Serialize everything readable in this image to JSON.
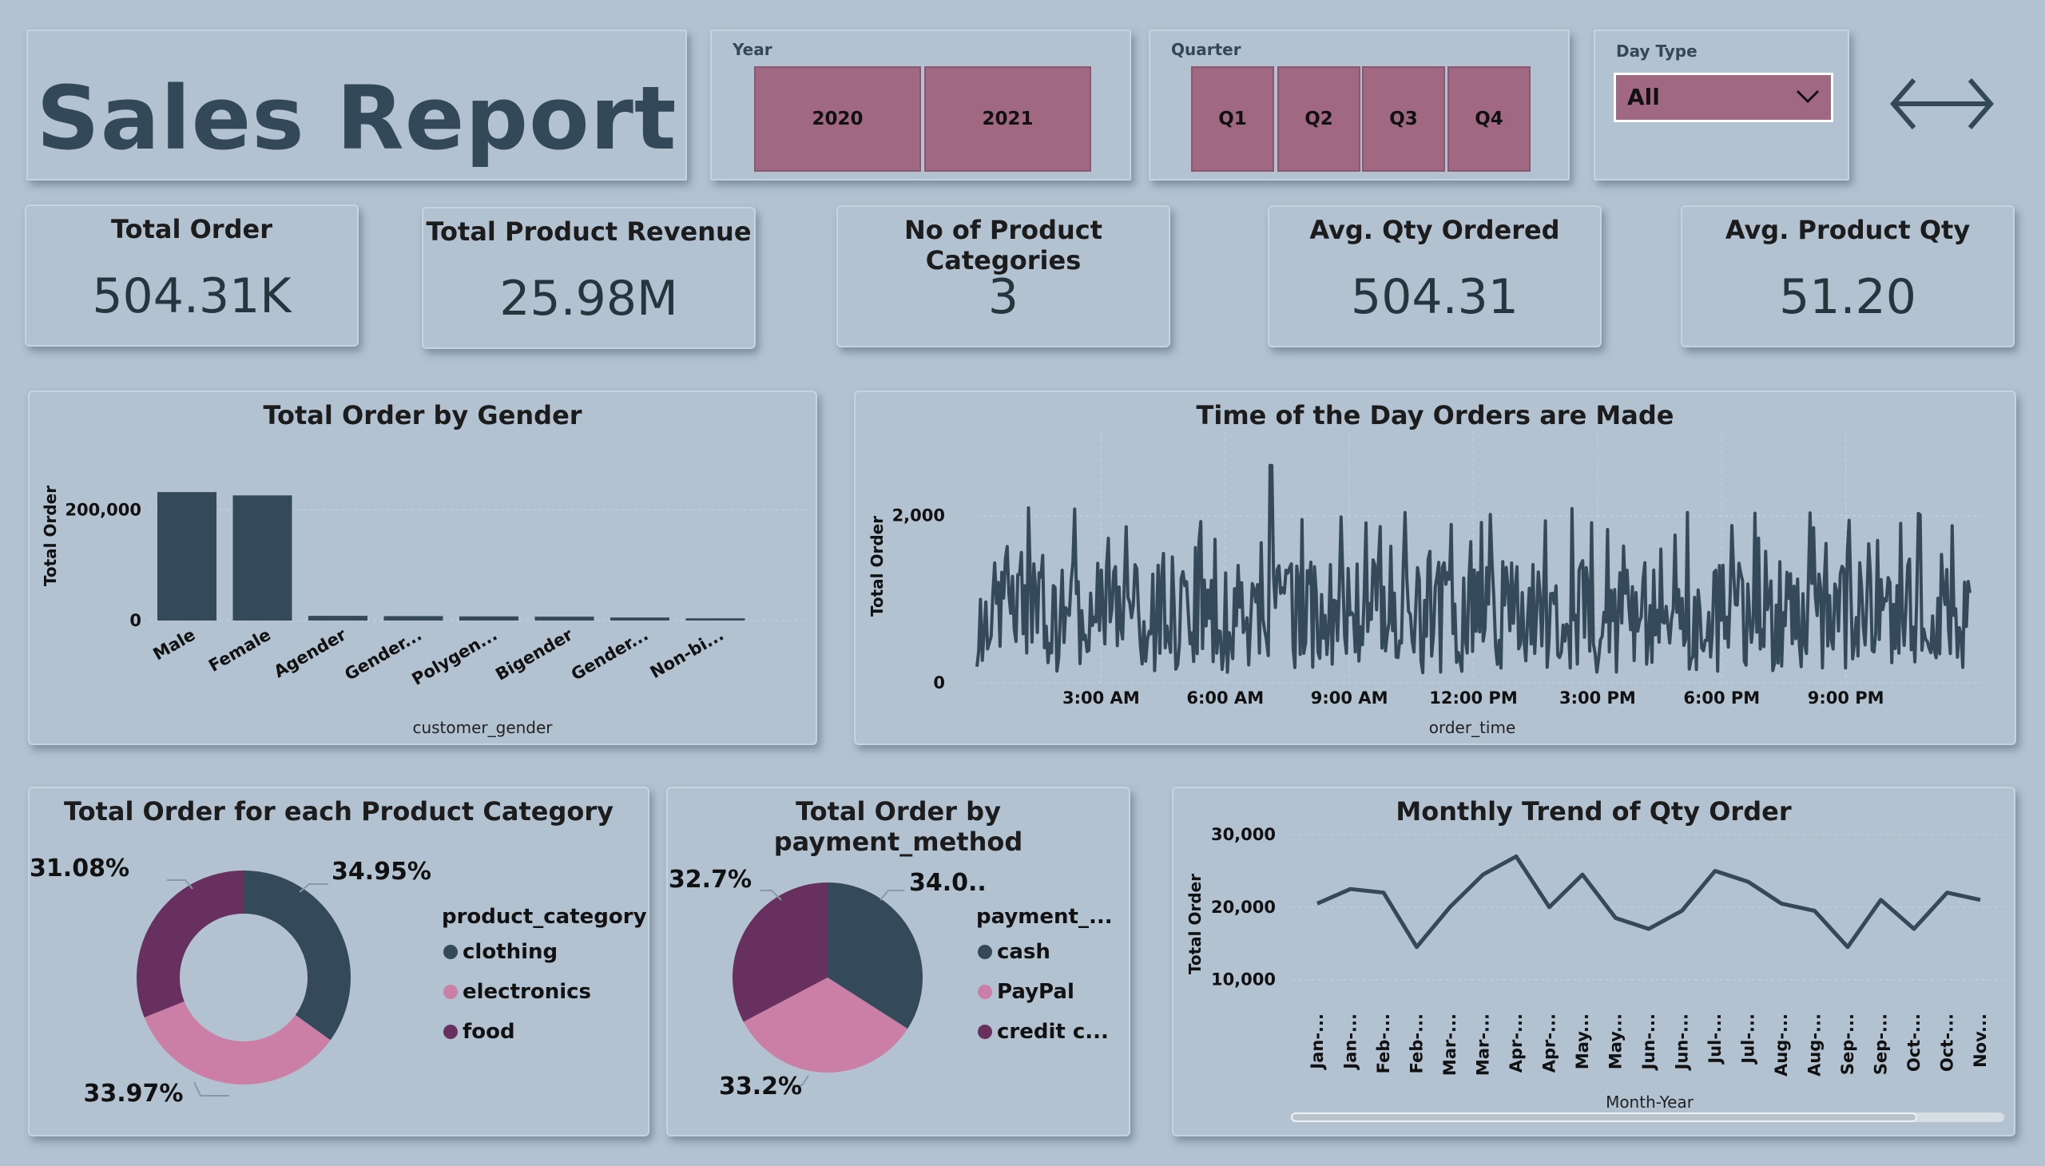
{
  "header": {
    "title": "Sales Report"
  },
  "slicers": {
    "year": {
      "label": "Year",
      "options": [
        "2020",
        "2021"
      ]
    },
    "quarter": {
      "label": "Quarter",
      "options": [
        "Q1",
        "Q2",
        "Q3",
        "Q4"
      ]
    },
    "day_type": {
      "label": "Day Type",
      "selected": "All"
    }
  },
  "nav": {
    "arrows_icon": "left-right-arrows-icon"
  },
  "kpis": [
    {
      "title": "Total Order",
      "value": "504.31K"
    },
    {
      "title": "Total Product Revenue",
      "value": "25.98M"
    },
    {
      "title": "No of Product Categories",
      "value": "3"
    },
    {
      "title": "Avg. Qty Ordered",
      "value": "504.31"
    },
    {
      "title": "Avg. Product Qty",
      "value": "51.20"
    }
  ],
  "colors": {
    "background": "#b2c2d0",
    "dark": "#34495a",
    "pink": "#cb7fa6",
    "purple": "#67305f",
    "tile": "#a16882"
  },
  "charts": {
    "gender": {
      "title": "Total Order by Gender",
      "xlabel": "customer_gender",
      "ylabel": "Total Order",
      "ticks": [
        "0",
        "200,000"
      ]
    },
    "time": {
      "title": "Time of the Day Orders are Made",
      "xlabel": "order_time",
      "ylabel": "Total Order",
      "yticks": [
        "0",
        "2,000"
      ],
      "xticks": [
        "3:00 AM",
        "6:00 AM",
        "9:00 AM",
        "12:00 PM",
        "3:00 PM",
        "6:00 PM",
        "9:00 PM"
      ]
    },
    "category": {
      "title": "Total Order for each Product Category",
      "legend_title": "product_category",
      "labels": [
        "34.95%",
        "33.97%",
        "31.08%"
      ]
    },
    "payment": {
      "title": "Total Order by payment_method",
      "legend_title": "payment_...",
      "labels": [
        "34.0...",
        "33.2%",
        "32.7%"
      ]
    },
    "monthly": {
      "title": "Monthly Trend of Qty Order",
      "xlabel": "Month-Year",
      "ylabel": "Total Order",
      "yticks": [
        "10,000",
        "20,000",
        "30,000"
      ]
    }
  },
  "chart_data": [
    {
      "type": "bar",
      "title": "Total Order by Gender",
      "xlabel": "customer_gender",
      "ylabel": "Total Order",
      "ylim": [
        0,
        300000
      ],
      "categories": [
        "Male",
        "Female",
        "Agender",
        "Gender...",
        "Polygen...",
        "Bigender",
        "Gender...",
        "Non-bi..."
      ],
      "values": [
        232000,
        226000,
        8500,
        8000,
        7500,
        7000,
        5500,
        4000
      ]
    },
    {
      "type": "line",
      "title": "Time of the Day Orders are Made",
      "xlabel": "order_time",
      "ylabel": "Total Order",
      "ylim": [
        0,
        3000
      ],
      "x_range_hours": [
        0,
        24
      ],
      "peak": 2600,
      "typical_range": [
        200,
        1800
      ]
    },
    {
      "type": "pie",
      "title": "Total Order for each Product Category",
      "legend_title": "product_category",
      "categories": [
        "clothing",
        "electronics",
        "food"
      ],
      "values": [
        34.95,
        33.97,
        31.08
      ],
      "labels": [
        "34.95%",
        "33.97%",
        "31.08%"
      ],
      "donut": true,
      "colors": [
        "#34495a",
        "#cb7fa6",
        "#67305f"
      ]
    },
    {
      "type": "pie",
      "title": "Total Order by payment_method",
      "legend_title": "payment_...",
      "categories": [
        "cash",
        "PayPal",
        "credit c..."
      ],
      "values": [
        34.05,
        33.2,
        32.7
      ],
      "labels": [
        "34.0...",
        "33.2%",
        "32.7%"
      ],
      "donut": false,
      "colors": [
        "#34495a",
        "#cb7fa6",
        "#67305f"
      ]
    },
    {
      "type": "line",
      "title": "Monthly Trend of Qty Order",
      "xlabel": "Month-Year",
      "ylabel": "Total Order",
      "ylim": [
        5000,
        32000
      ],
      "yticks": [
        10000,
        20000,
        30000
      ],
      "categories": [
        "Jan-...",
        "Jan-...",
        "Feb-...",
        "Feb-...",
        "Mar-...",
        "Mar-...",
        "Apr-...",
        "Apr-...",
        "May...",
        "May...",
        "Jun-...",
        "Jun-...",
        "Jul-...",
        "Jul-...",
        "Aug-...",
        "Aug-...",
        "Sep-...",
        "Sep-...",
        "Oct-...",
        "Oct-...",
        "Nov..."
      ],
      "values": [
        20500,
        22500,
        22000,
        14500,
        20000,
        24500,
        27000,
        20000,
        24500,
        18500,
        17000,
        19500,
        25000,
        23500,
        20500,
        19500,
        14500,
        21000,
        17000,
        22000,
        21000
      ]
    }
  ]
}
